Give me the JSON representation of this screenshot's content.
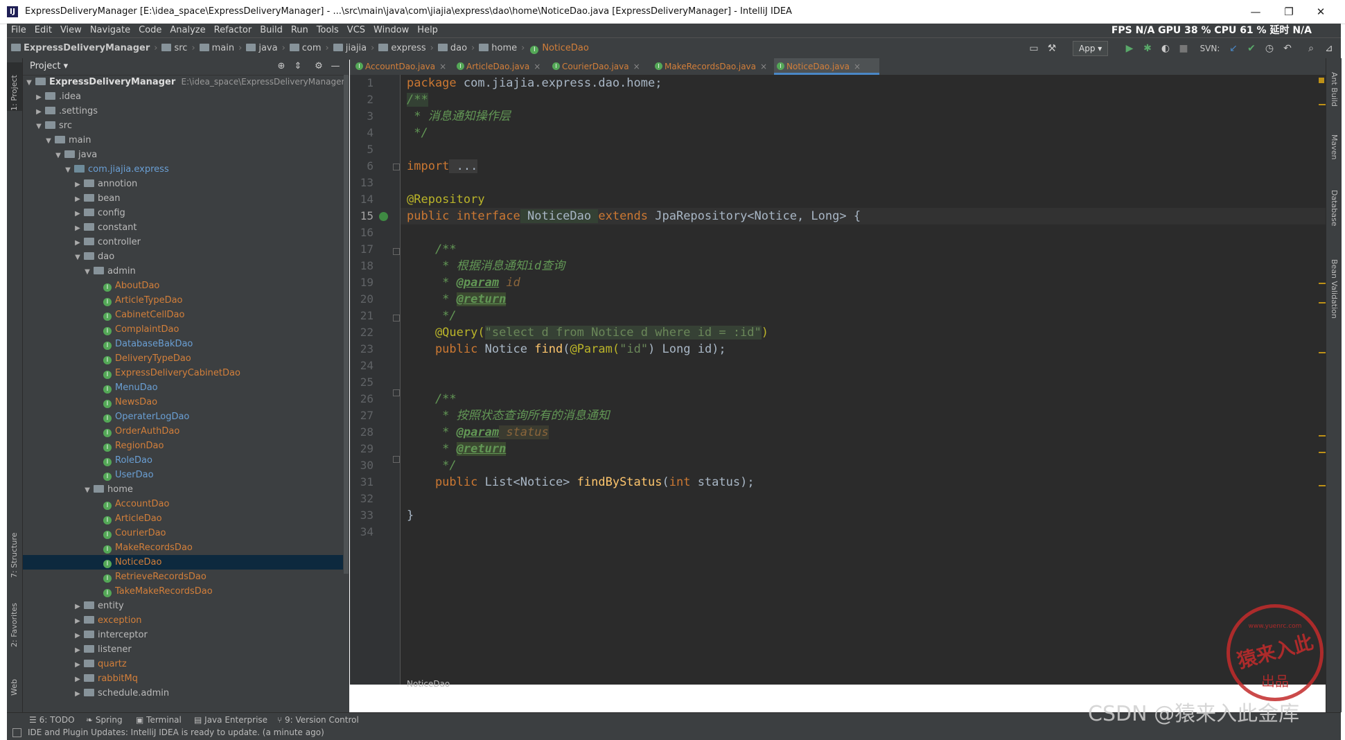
{
  "window": {
    "title": "ExpressDeliveryManager [E:\\idea_space\\ExpressDeliveryManager] - ...\\src\\main\\java\\com\\jiajia\\express\\dao\\home\\NoticeDao.java [ExpressDeliveryManager] - IntelliJ IDEA",
    "app_icon": "IJ"
  },
  "menu": [
    "File",
    "Edit",
    "View",
    "Navigate",
    "Code",
    "Analyze",
    "Refactor",
    "Build",
    "Run",
    "Tools",
    "VCS",
    "Window",
    "Help"
  ],
  "perf": "FPS N/A GPU 38 % CPU 61 % 延时 N/A",
  "breadcrumbs": [
    "ExpressDeliveryManager",
    "src",
    "main",
    "java",
    "com",
    "jiajia",
    "express",
    "dao",
    "home",
    "NoticeDao"
  ],
  "toolbar": {
    "run_config": "App ▾",
    "svn": "SVN:"
  },
  "project_panel": {
    "title": "Project ▾",
    "root_name": "ExpressDeliveryManager",
    "root_path": "E:\\idea_space\\ExpressDeliveryManager",
    "tree": [
      {
        "label": ".idea",
        "arrow": "▶",
        "type": "folder",
        "indent": 1
      },
      {
        "label": ".settings",
        "arrow": "▶",
        "type": "folder",
        "indent": 1
      },
      {
        "label": "src",
        "arrow": "▼",
        "type": "folder",
        "indent": 1
      },
      {
        "label": "main",
        "arrow": "▼",
        "type": "folder",
        "indent": 2
      },
      {
        "label": "java",
        "arrow": "▼",
        "type": "folder",
        "indent": 3
      },
      {
        "label": "com.jiajia.express",
        "arrow": "▼",
        "type": "pkg",
        "indent": 4
      },
      {
        "label": "annotion",
        "arrow": "▶",
        "type": "folder",
        "indent": 5
      },
      {
        "label": "bean",
        "arrow": "▶",
        "type": "folder",
        "indent": 5
      },
      {
        "label": "config",
        "arrow": "▶",
        "type": "folder",
        "indent": 5
      },
      {
        "label": "constant",
        "arrow": "▶",
        "type": "folder",
        "indent": 5
      },
      {
        "label": "controller",
        "arrow": "▶",
        "type": "folder",
        "indent": 5
      },
      {
        "label": "dao",
        "arrow": "▼",
        "type": "folder",
        "indent": 5
      },
      {
        "label": "admin",
        "arrow": "▼",
        "type": "folder",
        "indent": 6
      },
      {
        "label": "AboutDao",
        "type": "iface",
        "color": "orange",
        "indent": 7
      },
      {
        "label": "ArticleTypeDao",
        "type": "iface",
        "color": "orange",
        "indent": 7
      },
      {
        "label": "CabinetCellDao",
        "type": "iface",
        "color": "orange",
        "indent": 7
      },
      {
        "label": "ComplaintDao",
        "type": "iface",
        "color": "orange",
        "indent": 7
      },
      {
        "label": "DatabaseBakDao",
        "type": "iface",
        "color": "blue",
        "indent": 7
      },
      {
        "label": "DeliveryTypeDao",
        "type": "iface",
        "color": "orange",
        "indent": 7
      },
      {
        "label": "ExpressDeliveryCabinetDao",
        "type": "iface",
        "color": "orange",
        "indent": 7
      },
      {
        "label": "MenuDao",
        "type": "iface",
        "color": "blue",
        "indent": 7
      },
      {
        "label": "NewsDao",
        "type": "iface",
        "color": "orange",
        "indent": 7
      },
      {
        "label": "OperaterLogDao",
        "type": "iface",
        "color": "blue",
        "indent": 7
      },
      {
        "label": "OrderAuthDao",
        "type": "iface",
        "color": "orange",
        "indent": 7
      },
      {
        "label": "RegionDao",
        "type": "iface",
        "color": "orange",
        "indent": 7
      },
      {
        "label": "RoleDao",
        "type": "iface",
        "color": "blue",
        "indent": 7
      },
      {
        "label": "UserDao",
        "type": "iface",
        "color": "blue",
        "indent": 7
      },
      {
        "label": "home",
        "arrow": "▼",
        "type": "folder",
        "indent": 6
      },
      {
        "label": "AccountDao",
        "type": "iface",
        "color": "orange",
        "indent": 7
      },
      {
        "label": "ArticleDao",
        "type": "iface",
        "color": "orange",
        "indent": 7
      },
      {
        "label": "CourierDao",
        "type": "iface",
        "color": "orange",
        "indent": 7
      },
      {
        "label": "MakeRecordsDao",
        "type": "iface",
        "color": "orange",
        "indent": 7
      },
      {
        "label": "NoticeDao",
        "type": "iface",
        "color": "orange",
        "indent": 7,
        "selected": true
      },
      {
        "label": "RetrieveRecordsDao",
        "type": "iface",
        "color": "orange",
        "indent": 7
      },
      {
        "label": "TakeMakeRecordsDao",
        "type": "iface",
        "color": "orange",
        "indent": 7
      },
      {
        "label": "entity",
        "arrow": "▶",
        "type": "folder",
        "indent": 5
      },
      {
        "label": "exception",
        "arrow": "▶",
        "type": "folder",
        "color": "orange",
        "indent": 5
      },
      {
        "label": "interceptor",
        "arrow": "▶",
        "type": "folder",
        "indent": 5
      },
      {
        "label": "listener",
        "arrow": "▶",
        "type": "folder",
        "indent": 5
      },
      {
        "label": "quartz",
        "arrow": "▶",
        "type": "folder",
        "color": "orange",
        "indent": 5
      },
      {
        "label": "rabbitMq",
        "arrow": "▶",
        "type": "folder",
        "color": "orange",
        "indent": 5
      },
      {
        "label": "schedule.admin",
        "arrow": "▶",
        "type": "folder",
        "indent": 5
      }
    ]
  },
  "tabs": [
    {
      "label": "AccountDao.java",
      "active": false
    },
    {
      "label": "ArticleDao.java",
      "active": false
    },
    {
      "label": "CourierDao.java",
      "active": false
    },
    {
      "label": "MakeRecordsDao.java",
      "active": false
    },
    {
      "label": "NoticeDao.java",
      "active": true
    }
  ],
  "editor": {
    "line_numbers": [
      "1",
      "2",
      "3",
      "4",
      "5",
      "6",
      "13",
      "14",
      "15",
      "16",
      "17",
      "18",
      "19",
      "20",
      "21",
      "22",
      "23",
      "24",
      "25",
      "26",
      "27",
      "28",
      "29",
      "30",
      "31",
      "32",
      "33",
      "34"
    ],
    "code": {
      "l1_kw": "package",
      "l1_rest": " com.jiajia.express.dao.home;",
      "l2": "/**",
      "l3": " * 消息通知操作层",
      "l4": " */",
      "l6_kw": "import",
      "l6_rest": " ...",
      "l14": "@Repository",
      "l15_a": "public interface",
      "l15_b": " NoticeDao ",
      "l15_c": "extends",
      "l15_d": " JpaRepository<Notice, Long> {",
      "l17": "    /**",
      "l18": "     * 根据消息通知id查询",
      "l19_a": "     * ",
      "l19_tag": "@param",
      "l19_b": " id",
      "l20_a": "     * ",
      "l20_tag": "@return",
      "l21": "     */",
      "l22_ann": "    @Query(",
      "l22_str": "\"select d from Notice d where id = :id\"",
      "l22_end": ")",
      "l23_kw": "    public",
      "l23_a": " Notice ",
      "l23_fn": "find",
      "l23_b": "(",
      "l23_ann": "@Param(",
      "l23_str": "\"id\"",
      "l23_c": ") Long id);",
      "l26": "    /**",
      "l27": "     * 按照状态查询所有的消息通知",
      "l28_a": "     * ",
      "l28_tag": "@param",
      "l28_b": " status",
      "l29_a": "     * ",
      "l29_tag": "@return",
      "l30": "     */",
      "l31_kw": "    public",
      "l31_a": " List<Notice> ",
      "l31_fn": "findByStatus",
      "l31_b": "(",
      "l31_kw2": "int",
      "l31_c": " status);",
      "l33": "}"
    },
    "breadcrumb": "NoticeDao"
  },
  "left_tool_tabs": [
    "1: Project",
    "7: Structure",
    "2: Favorites",
    "Web"
  ],
  "right_tool_tabs": [
    "Ant Build",
    "Maven",
    "Database",
    "Bean Validation"
  ],
  "bottom_tools": [
    "6: TODO",
    "Spring",
    "Terminal",
    "Java Enterprise",
    "9: Version Control"
  ],
  "status_message": "IDE and Plugin Updates: IntelliJ IDEA is ready to update. (a minute ago)",
  "watermark": "CSDN @猿来入此金库",
  "seal": {
    "top": "www.yuenrc.com",
    "main": "猿来入此",
    "bottom": "出品"
  }
}
